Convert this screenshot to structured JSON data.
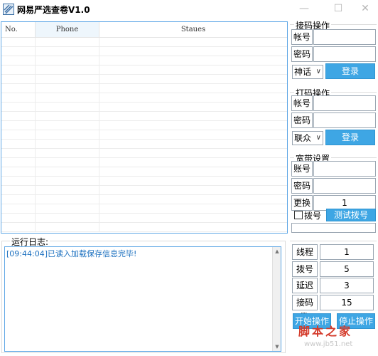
{
  "window": {
    "title": "网易严选查卷V1.0",
    "minimize": "—",
    "maximize": "☐",
    "close": "✕"
  },
  "table": {
    "columns": [
      "No.",
      "Phone",
      "Staues"
    ],
    "rows": []
  },
  "receive": {
    "title": "接码操作",
    "account_label": "帐号",
    "password_label": "密码",
    "platform": "神话",
    "login_label": "登录"
  },
  "captcha": {
    "title": "打码操作",
    "account_label": "帐号",
    "password_label": "密码",
    "platform": "联众",
    "login_label": "登录"
  },
  "broadband": {
    "title": "宽带设置",
    "account_label": "账号",
    "password_label": "密码",
    "change_label": "更换",
    "change_value": "1",
    "dial_label": "拨号",
    "test_dial_label": "测试拨号"
  },
  "log": {
    "title": "运行日志:",
    "lines": [
      "[09:44:04]已读入加载保存信息完毕!"
    ]
  },
  "settings": {
    "threads_label": "线程数",
    "threads_value": "1",
    "dial_time_label": "拨号时",
    "dial_time_value": "5",
    "delay_label": "延迟数",
    "delay_value": "3",
    "receive_count_label": "接码数",
    "receive_count_value": "15"
  },
  "actions": {
    "start_label": "开始操作",
    "stop_label": "停止操作"
  },
  "watermark": {
    "text": "脚本之家",
    "url": "www.jb51.net"
  },
  "colors": {
    "accent": "#3ea6e4",
    "border": "#60a8e6",
    "log_text": "#1a6fbf",
    "watermark": "#d43a2a"
  }
}
